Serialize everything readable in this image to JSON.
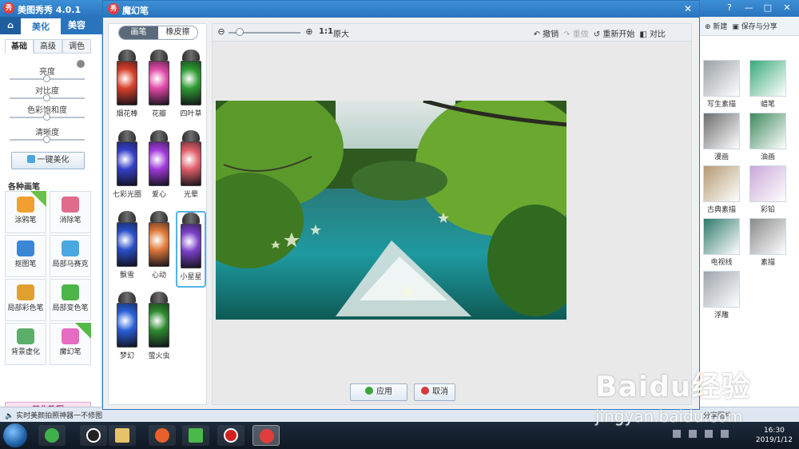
{
  "app": {
    "title": "美图秀秀 4.0.1",
    "window_controls": [
      "?",
      "—",
      "□",
      "✕"
    ],
    "nav": {
      "home_icon": "home-icon",
      "tabs": [
        "美化",
        "美容"
      ]
    },
    "subtabs": [
      "基础",
      "高级",
      "调色"
    ],
    "sliders": [
      {
        "label": "亮度",
        "value": 0.5
      },
      {
        "label": "对比度",
        "value": 0.5
      },
      {
        "label": "色彩饱和度",
        "value": 0.5
      },
      {
        "label": "清晰度",
        "value": 0.5
      }
    ],
    "one_key": "一键美化",
    "brushes_title": "各种画笔",
    "brushes": [
      {
        "label": "涂鸦笔",
        "tag": "升级",
        "color": "#f0a030"
      },
      {
        "label": "消除笔",
        "color": "#e06b8b"
      },
      {
        "label": "抠图笔",
        "color": "#3a87d6"
      },
      {
        "label": "局部马赛克",
        "color": "#4aa8e0"
      },
      {
        "label": "局部彩色笔",
        "color": "#e0a030"
      },
      {
        "label": "局部变色笔",
        "color": "#4bb548"
      },
      {
        "label": "背景虚化",
        "color": "#5cae6a"
      },
      {
        "label": "魔幻笔",
        "tag": "new",
        "color": "#e56cc0"
      }
    ],
    "tutorial": "美化教程",
    "status_left": "实时美颜拍照神器一不修图",
    "status_right": "分享图片"
  },
  "right_panel": {
    "new_label": "新建",
    "save_label": "保存与分享",
    "effects": [
      {
        "label": "写生素描",
        "color": "#9aa0a4"
      },
      {
        "label": "蜡笔",
        "color": "#3aaa7a"
      },
      {
        "label": "漫画",
        "color": "#6c6c6c"
      },
      {
        "label": "油画",
        "color": "#3f8a5c"
      },
      {
        "label": "古典素描",
        "color": "#b39a72"
      },
      {
        "label": "彩铅",
        "color": "#c9a8d8"
      },
      {
        "label": "电视线",
        "color": "#2e7a6a"
      },
      {
        "label": "素描",
        "color": "#8a8a8a"
      },
      {
        "label": "浮雕",
        "color": "#9ea4ab"
      }
    ]
  },
  "dialog": {
    "title": "魔幻笔",
    "close_icon": "close-icon",
    "mode_toggle": [
      "画笔",
      "橡皮擦"
    ],
    "mode_active": "画笔",
    "pens": [
      {
        "label": "烟花棒",
        "color": "#d6402a"
      },
      {
        "label": "花瓣",
        "color": "#e04aa8"
      },
      {
        "label": "四叶草",
        "color": "#2e9a32"
      },
      {
        "label": "七彩光圈",
        "color": "#3640c8"
      },
      {
        "label": "爱心",
        "color": "#a03ad8"
      },
      {
        "label": "光晕",
        "color": "#e0606a"
      },
      {
        "label": "飘雪",
        "color": "#2a50c8"
      },
      {
        "label": "心动",
        "color": "#e07a3a"
      },
      {
        "label": "小星星",
        "color": "#7a40c8"
      },
      {
        "label": "梦幻",
        "color": "#2a60d8"
      },
      {
        "label": "萤火虫",
        "color": "#2e8a2e"
      }
    ],
    "selected_pen": "小星星",
    "toolbar": {
      "zoom_ratio": "1:1",
      "zoom_orig": "原大",
      "zoom_level": 0.15,
      "undo": "撤销",
      "redo": "重做",
      "restart": "重新开始",
      "compare": "对比"
    },
    "apply": "应用",
    "cancel": "取消"
  },
  "taskbar": {
    "time": "16:30",
    "date": "2019/1/12"
  },
  "watermark": {
    "main": "Baidu经验",
    "sub": "jingyan.baidu.com"
  }
}
